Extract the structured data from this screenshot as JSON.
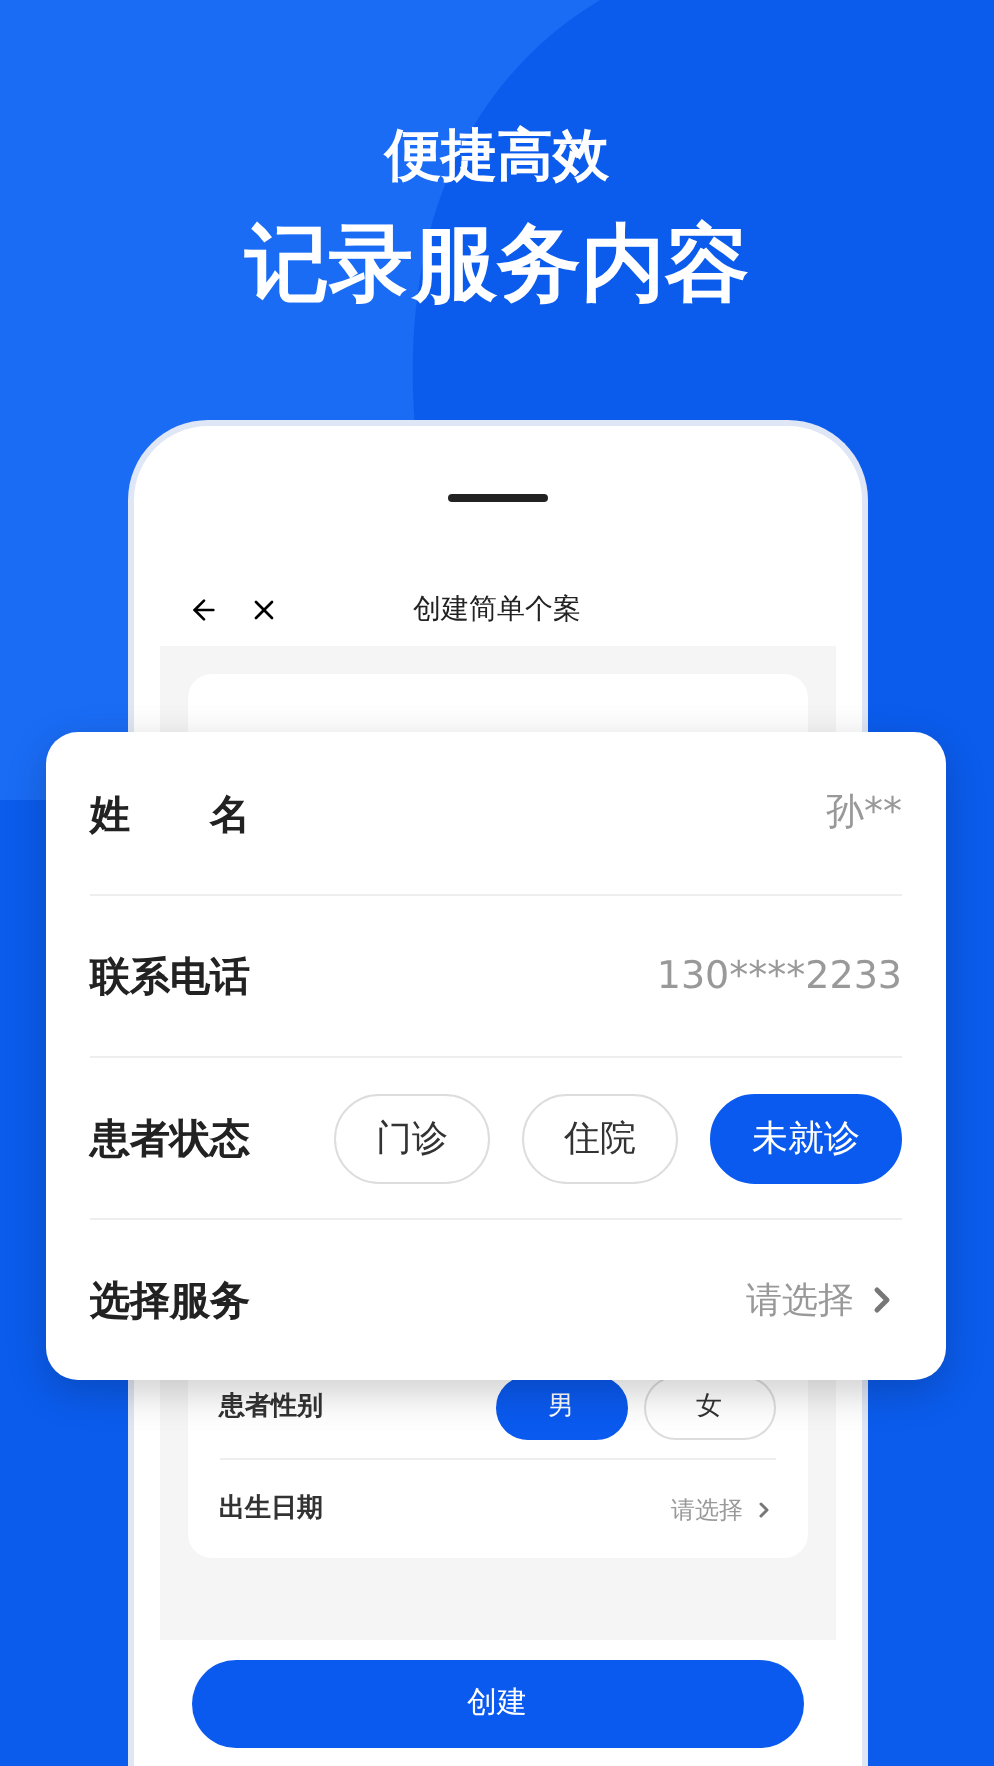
{
  "headline": {
    "subtitle": "便捷高效",
    "title": "记录服务内容"
  },
  "phone": {
    "nav_title": "创建简单个案",
    "rows": [
      {
        "kind": "options",
        "label": "患者性别",
        "options": [
          {
            "label": "男",
            "selected": true
          },
          {
            "label": "女",
            "selected": false
          }
        ]
      },
      {
        "kind": "select",
        "label": "出生日期",
        "value": "请选择"
      }
    ],
    "create_button": "创建"
  },
  "form_card": {
    "rows": [
      {
        "kind": "text",
        "label": "姓　　名",
        "value": "孙**"
      },
      {
        "kind": "text",
        "label": "联系电话",
        "value": "130****2233"
      },
      {
        "kind": "options",
        "label": "患者状态",
        "options": [
          {
            "label": "门诊",
            "selected": false
          },
          {
            "label": "住院",
            "selected": false
          },
          {
            "label": "未就诊",
            "selected": true
          }
        ]
      },
      {
        "kind": "select",
        "label": "选择服务",
        "value": "请选择"
      }
    ]
  }
}
